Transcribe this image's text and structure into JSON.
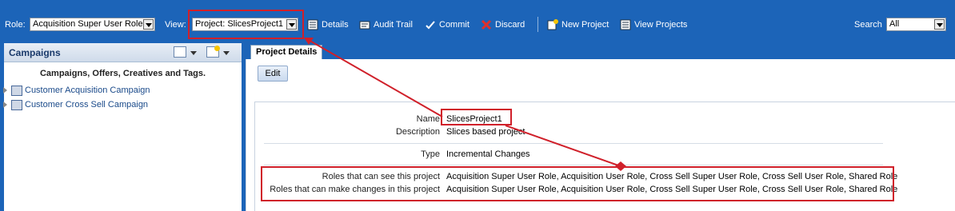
{
  "toolbar": {
    "role_label": "Role:",
    "role_value": "Acquisition Super User Role",
    "view_label": "View:",
    "view_value": "Project: SlicesProject1",
    "details": "Details",
    "audit_trail": "Audit Trail",
    "commit": "Commit",
    "discard": "Discard",
    "new_project": "New Project",
    "view_projects": "View Projects",
    "search_label": "Search",
    "search_value": "All"
  },
  "sidebar": {
    "title": "Campaigns",
    "subtitle": "Campaigns, Offers, Creatives and Tags.",
    "items": [
      {
        "label": "Customer Acquisition Campaign"
      },
      {
        "label": "Customer Cross Sell Campaign"
      }
    ]
  },
  "main": {
    "tab_label": "Project Details",
    "edit_label": "Edit",
    "fields": {
      "name_label": "Name",
      "name_value": "SlicesProject1",
      "description_label": "Description",
      "description_value": "Slices based project",
      "type_label": "Type",
      "type_value": "Incremental Changes",
      "roles_see_label": "Roles that can see this project",
      "roles_see_value": "Acquisition Super User Role, Acquisition User Role, Cross Sell Super User Role, Cross Sell User Role, Shared Role",
      "roles_change_label": "Roles that can make changes in this project",
      "roles_change_value": "Acquisition Super User Role, Acquisition User Role, Cross Sell Super User Role, Cross Sell User Role, Shared Role"
    }
  },
  "colors": {
    "toolbar_bg": "#1c64b8",
    "highlight": "#d0202a"
  }
}
